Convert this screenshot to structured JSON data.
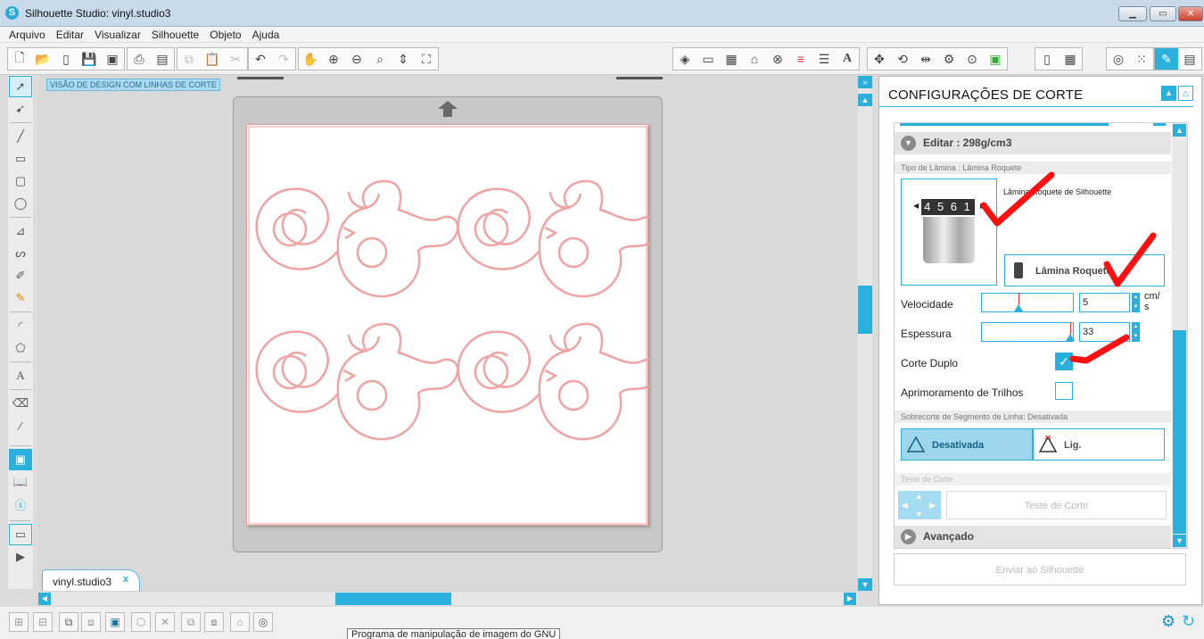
{
  "window": {
    "title": "Silhouette Studio: vinyl.studio3",
    "logo": "S",
    "minimize": "▁",
    "maximize": "▭",
    "close": "✕"
  },
  "menu": [
    "Arquivo",
    "Editar",
    "Visualizar",
    "Silhouette",
    "Objeto",
    "Ajuda"
  ],
  "canvas": {
    "label": "VISÃO DE DESIGN COM LINHAS DE CORTE",
    "tab": "vinyl.studio3",
    "tab_close": "x"
  },
  "panel": {
    "title": "CONFIGURAÇÕES DE CORTE",
    "edit_header": "Editar : 298g/cm3",
    "blade_type": "Tipo de Lâmina : Lâmina Roquete",
    "blade_desc": "Lâmina Roquete de Silhouette",
    "blade_button": "Lâmina Roquete",
    "blade_ratchet_numbers": "4 5 6 1",
    "speed": {
      "label": "Velocidade",
      "value": "5",
      "unit": "cm/\ns",
      "level": 0.4
    },
    "thickness": {
      "label": "Espessura",
      "value": "33",
      "level": 0.97
    },
    "double_cut": {
      "label": "Corte Duplo",
      "checked": true
    },
    "track_enhance": {
      "label": "Aprimoramento de Trilhos",
      "checked": false
    },
    "overcut": "Sobrecorte de Segmento de Linha: Desativada",
    "overcut_off": "Desativada",
    "overcut_on": "Lig.",
    "test_section": "Teste de Corte",
    "test_button": "Teste de Corte",
    "advanced": "Avançado",
    "send": "Enviar ao Silhouette"
  },
  "tooltip": "Programa de manipulação de imagem do GNU",
  "colors": {
    "accent": "#2ab0dc",
    "cutline": "#f0a0a0",
    "annotation": "#ff0000"
  }
}
